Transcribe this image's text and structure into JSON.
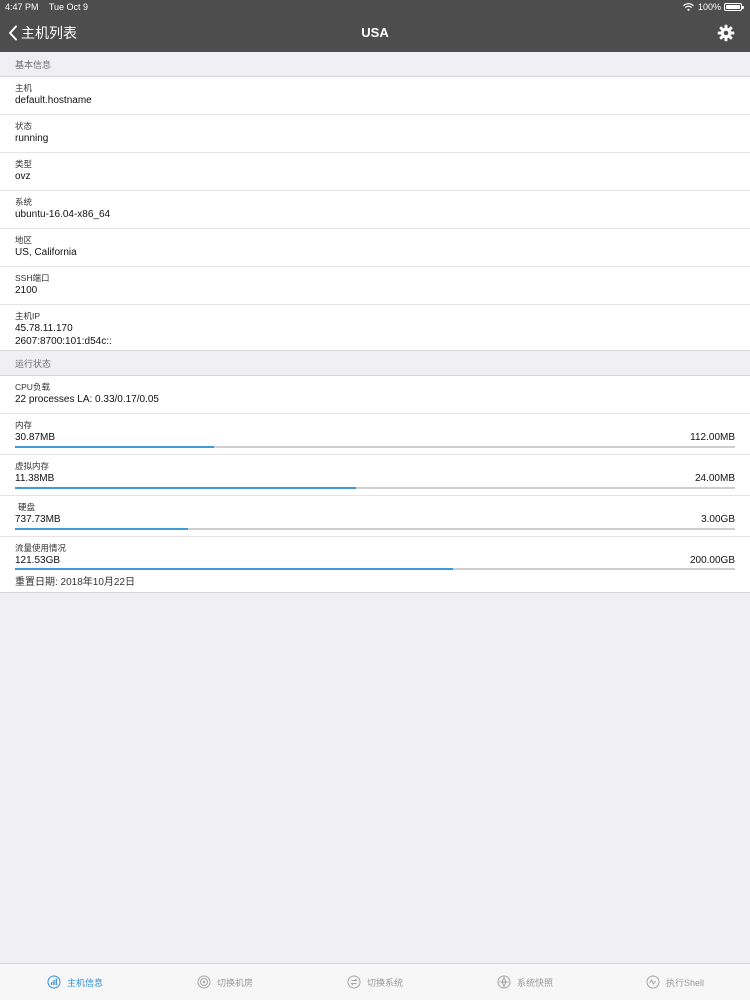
{
  "status_bar": {
    "time": "4:47 PM",
    "date": "Tue Oct 9",
    "battery": "100%"
  },
  "nav": {
    "back_label": "主机列表",
    "title": "USA"
  },
  "basic": {
    "header": "基本信息",
    "hostname": {
      "label": "主机",
      "value": "default.hostname"
    },
    "state": {
      "label": "状态",
      "value": "running"
    },
    "type": {
      "label": "类型",
      "value": "ovz"
    },
    "os": {
      "label": "系统",
      "value": "ubuntu-16.04-x86_64"
    },
    "region": {
      "label": "地区",
      "value": "US, California"
    },
    "ssh": {
      "label": "SSH端口",
      "value": "2100"
    },
    "ip": {
      "label": "主机IP",
      "ipv4": "45.78.11.170",
      "ipv6": "2607:8700:101:d54c::"
    }
  },
  "running": {
    "header": "运行状态",
    "cpu": {
      "label": "CPU负载",
      "value": "22 processes LA: 0.33/0.17/0.05"
    },
    "memory": {
      "label": "内存",
      "used": "30.87MB",
      "total": "112.00MB",
      "fraction": 0.276
    },
    "swap": {
      "label": "虚拟内存",
      "used": "11.38MB",
      "total": "24.00MB",
      "fraction": 0.474
    },
    "disk": {
      "label": "硬盘",
      "used": "737.73MB",
      "total": "3.00GB",
      "fraction": 0.24
    },
    "traffic": {
      "label": "流量使用情况",
      "used": "121.53GB",
      "total": "200.00GB",
      "fraction": 0.608,
      "reset_date": "重置日期: 2018年10月22日"
    }
  },
  "tabs": [
    {
      "label": "主机信息",
      "icon": "host-info-icon"
    },
    {
      "label": "切换机房",
      "icon": "switch-datacenter-icon"
    },
    {
      "label": "切换系统",
      "icon": "switch-os-icon"
    },
    {
      "label": "系统快照",
      "icon": "snapshot-icon"
    },
    {
      "label": "执行Shell",
      "icon": "shell-icon"
    }
  ],
  "colors": {
    "accent": "#3f9ad8",
    "nav": "#4d4d4d",
    "background": "#efeff4",
    "tab_active": "#2e8ed6"
  }
}
